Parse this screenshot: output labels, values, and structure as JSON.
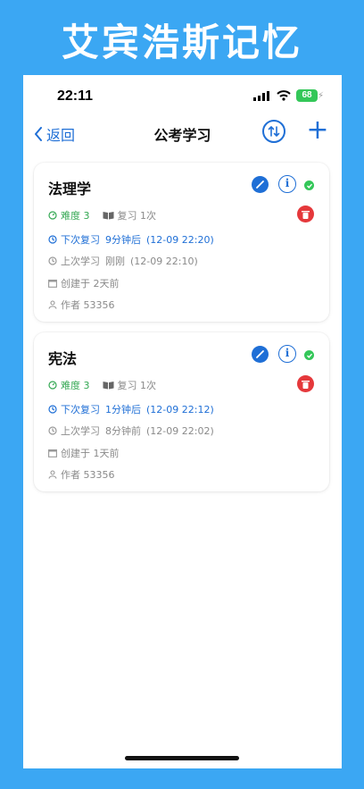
{
  "banner": "艾宾浩斯记忆",
  "status": {
    "time": "22:11",
    "battery": "68"
  },
  "nav": {
    "back_label": "返回",
    "title": "公考学习",
    "plus": "+"
  },
  "cards": [
    {
      "title": "法理学",
      "difficulty": "难度 3",
      "reviews": "复习 1次",
      "next_label": "下次复习",
      "next_rel": "9分钟后",
      "next_time": "(12-09 22:20)",
      "last_label": "上次学习",
      "last_rel": "刚刚",
      "last_time": "(12-09 22:10)",
      "created": "创建于 2天前",
      "author": "作者 53356"
    },
    {
      "title": "宪法",
      "difficulty": "难度 3",
      "reviews": "复习 1次",
      "next_label": "下次复习",
      "next_rel": "1分钟后",
      "next_time": "(12-09 22:12)",
      "last_label": "上次学习",
      "last_rel": "8分钟前",
      "last_time": "(12-09 22:02)",
      "created": "创建于 1天前",
      "author": "作者 53356"
    }
  ],
  "colors": {
    "background": "#3ba7f3",
    "accent": "#1f6fd6",
    "success": "#34c759",
    "danger": "#e5383b"
  }
}
